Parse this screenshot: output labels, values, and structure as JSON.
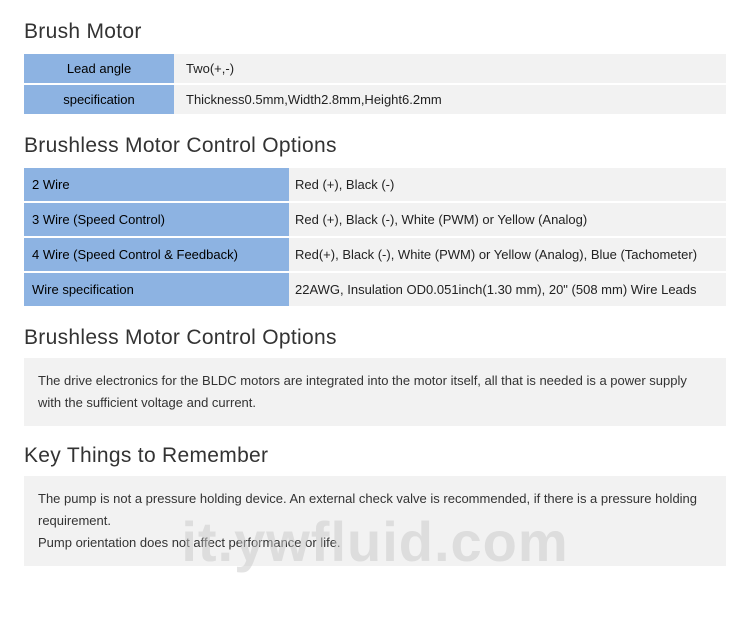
{
  "section1": {
    "title": "Brush Motor",
    "rows": [
      {
        "label": "Lead angle",
        "value": "Two(+,-)"
      },
      {
        "label": "specification",
        "value": "Thickness0.5mm,Width2.8mm,Height6.2mm"
      }
    ]
  },
  "section2": {
    "title": "Brushless Motor Control Options",
    "rows": [
      {
        "label": "2 Wire",
        "value": "Red (+), Black (-)"
      },
      {
        "label": "3 Wire (Speed Control)",
        "value": "Red (+), Black (-), White (PWM) or Yellow (Analog)"
      },
      {
        "label": "4 Wire (Speed Control & Feedback)",
        "value": "Red(+), Black (-), White (PWM) or Yellow (Analog), Blue (Tachometer)"
      },
      {
        "label": "Wire specification",
        "value": "22AWG, Insulation OD0.051inch(1.30 mm), 20\" (508 mm) Wire Leads"
      }
    ]
  },
  "section3": {
    "title": "Brushless Motor Control Options",
    "text": "The drive electronics for the BLDC motors are integrated into the motor itself, all that is needed is a power supply with the sufficient voltage and current."
  },
  "section4": {
    "title": "Key Things to Remember",
    "text": "The pump is not a pressure holding device. An external check valve is recommended, if there is a pressure holding requirement.\nPump orientation does not affect performance or life."
  },
  "watermark": "it.ywfluid.com"
}
